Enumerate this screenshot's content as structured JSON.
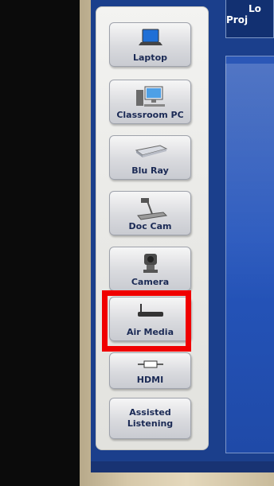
{
  "header": {
    "title_line1": "Lo",
    "title_line2": "Proj"
  },
  "sources": [
    {
      "label": "Laptop",
      "icon": "laptop-icon"
    },
    {
      "label": "Classroom PC",
      "icon": "desktop-pc-icon"
    },
    {
      "label": "Blu Ray",
      "icon": "blu-ray-player-icon"
    },
    {
      "label": "Doc Cam",
      "icon": "document-camera-icon"
    },
    {
      "label": "Camera",
      "icon": "camera-icon"
    },
    {
      "label": "Air Media",
      "icon": "air-media-device-icon"
    },
    {
      "label": "HDMI",
      "icon": "hdmi-cable-icon"
    },
    {
      "label_line1": "Assisted",
      "label_line2": "Listening"
    }
  ],
  "selected_source": "Air Media",
  "colors": {
    "highlight": "#f00000",
    "screen_blue": "#2656bd",
    "label": "#1b2a55"
  }
}
